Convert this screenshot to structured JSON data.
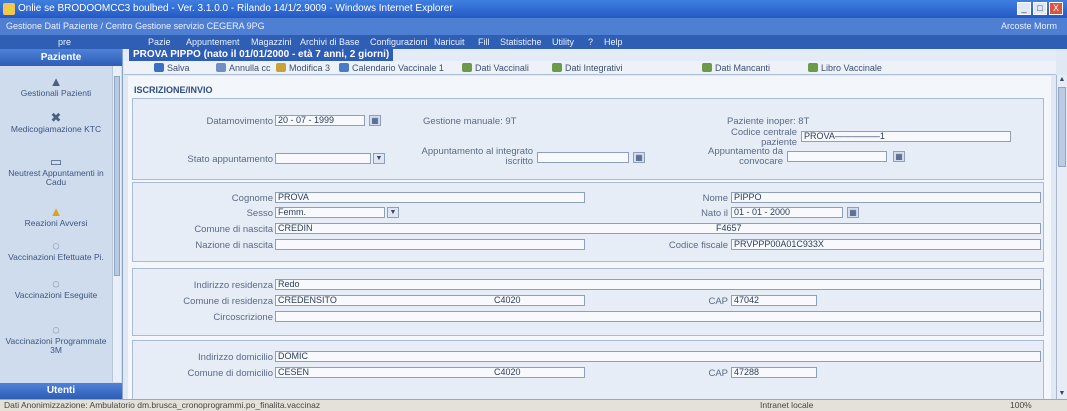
{
  "window": {
    "title": "Onlie se BRODOOMCC3 boulbed - Ver. 3.1.0.0 - Rilando 14/1/2.9009 - Windows Internet Explorer",
    "controls": [
      "_",
      "□",
      "X"
    ]
  },
  "subtitle": {
    "text": "Gestione Dati Paziente / Centro Gestione servizio CEGERA 9PG",
    "user": "Arcoste Morm"
  },
  "menu": [
    "pre",
    "Pazie",
    "Appuntement",
    "Magazzini",
    "Archivi di Base",
    "Configurazioni",
    "Naricuit",
    "Fill",
    "Statistiche",
    "Utility",
    "?",
    "Help"
  ],
  "sidebar": {
    "header": "Paziente",
    "footer": "Utenti",
    "items": [
      {
        "label": "Gestionali Pazienti",
        "icon": "patient-icon",
        "glyph": "▲"
      },
      {
        "label": "Medicogiamazione KTC",
        "icon": "medical-icon",
        "glyph": "✖"
      },
      {
        "label": "Neutrest Appuntamenti in Cadu",
        "icon": "calendar-icon",
        "glyph": "▭"
      },
      {
        "label": "Reazioni Avversi",
        "icon": "warning-icon",
        "glyph": "▲"
      },
      {
        "label": "Vaccinazioni Efettuate Pi.",
        "icon": "syringe-icon",
        "glyph": "◌"
      },
      {
        "label": "Vaccinazioni Eseguite",
        "icon": "syringe-icon",
        "glyph": "◌"
      },
      {
        "label": "Vaccinazioni Programmate 3M",
        "icon": "syringe-icon",
        "glyph": "◌"
      }
    ]
  },
  "tab": {
    "title": "PROVA PIPPO (nato il 01/01/2000 - età 7 anni, 2 giorni)"
  },
  "toolbar": {
    "items": [
      "Salva",
      "Annulla cc",
      "Modifica 3",
      "Calendario Vaccinale 1",
      "Dati Vaccinali",
      "Dati Integrativi",
      "Dati Mancanti",
      "Libro Vaccinale"
    ]
  },
  "section": {
    "title": "ISCRIZIONE/INVIO"
  },
  "panel1": {
    "data_movimento_label": "Datamovimento",
    "data_movimento_value": "20 - 07 - 1999",
    "gestione_manuale_label": "Gestione manuale: 9T",
    "paziente_inoper_label": "Paziente inoper: 8T",
    "codice_centrale_label": "Codice centrale paziente",
    "codice_centrale_value": "PROVA—————1",
    "stato_appuntamento_label": "Stato appuntamento",
    "stato_appuntamento_value": "",
    "appuntamento_label": "Appuntamento al integrato iscritto",
    "appuntamento_value": "",
    "appuntamento_convoc_label": "Appuntamento da convocare",
    "appuntamento_convoc_value": ""
  },
  "panel2": {
    "cognome_label": "Cognome",
    "cognome_value": "PROVA",
    "nome_label": "Nome",
    "nome_value": "PIPPO",
    "sesso_label": "Sesso",
    "sesso_value": "Femm.",
    "nato_label": "Nato il",
    "nato_value": "01 - 01 - 2000",
    "comune_nascita_label": "Comune di nascita",
    "comune_nascita_value": "CREDIN",
    "comune_nascita_code": "F4657",
    "nazione_label": "Nazione di nascita",
    "nazione_value": "",
    "codice_fiscale_label": "Codice fiscale",
    "codice_fiscale_value": "PRVPPP00A01C933X"
  },
  "panel3": {
    "indirizzo_residenza_label": "Indirizzo residenza",
    "indirizzo_residenza_value": "Redo",
    "comune_residenza_label": "Comune di residenza",
    "comune_residenza_value": "CREDENSITO",
    "comune_residenza_code": "C4020",
    "cap_label": "CAP",
    "cap_value": "47042",
    "circoscrizione_label": "Circoscrizione",
    "circoscrizione_value": ""
  },
  "panel4": {
    "indirizzo_domicilio_label": "Indirizzo domicilio",
    "indirizzo_domicilio_value": "DOMIC",
    "comune_domicilio_label": "Comune di domicilio",
    "comune_domicilio_value": "CESEN",
    "comune_domicilio_code": "C4020",
    "cap_label": "CAP",
    "cap_value": "47288"
  },
  "statusbar": {
    "left": "Dati Anonimizzazione: Ambulatorio dm.brusca_cronoprogrammi.po_finalita.vaccinaz",
    "zone": "Intranet locale",
    "zoom": "100%"
  },
  "colors": {
    "title_blue": "#2459c4",
    "panel_bg": "#e7edf6",
    "accent": "#2d5db5"
  }
}
